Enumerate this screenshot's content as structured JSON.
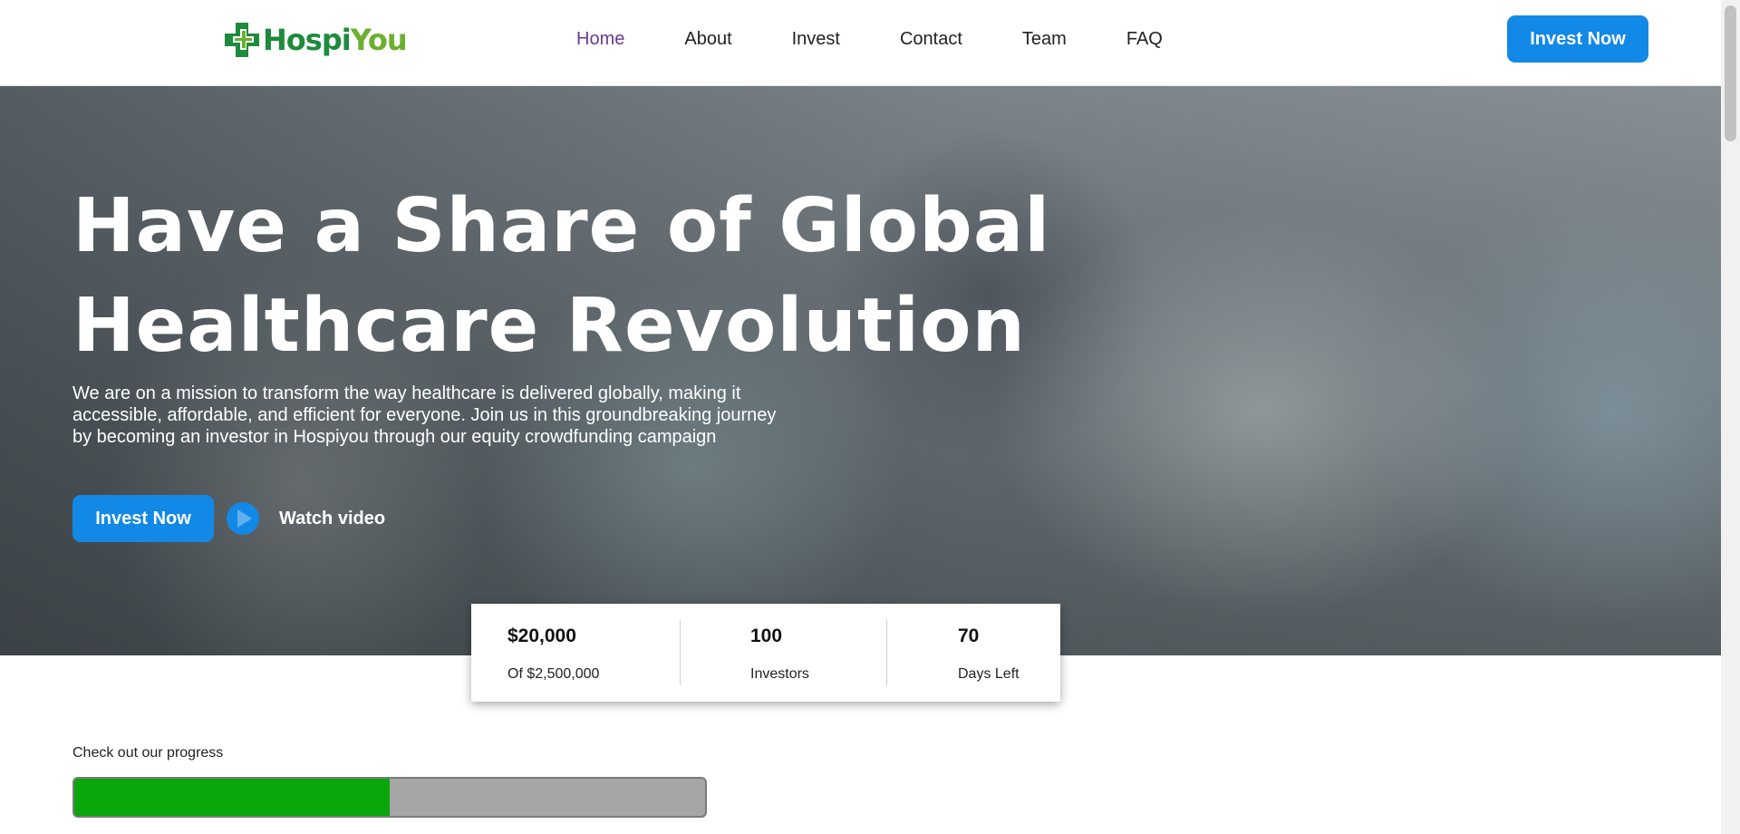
{
  "brand": {
    "name_part1": "Hospi",
    "name_part2": "You",
    "color_dark_green": "#1e8a3c",
    "color_light_green": "#6bb02e",
    "icon": "medical-cross-logo"
  },
  "nav": {
    "items": [
      {
        "label": "Home",
        "active": true
      },
      {
        "label": "About",
        "active": false
      },
      {
        "label": "Invest",
        "active": false
      },
      {
        "label": "Contact",
        "active": false
      },
      {
        "label": "Team",
        "active": false
      },
      {
        "label": "FAQ",
        "active": false
      }
    ],
    "active_color": "#6a3b8e"
  },
  "header": {
    "cta_label": "Invest Now"
  },
  "colors": {
    "accent_blue": "#1289e6",
    "progress_green": "#0aa70a"
  },
  "hero": {
    "title_line1": "Have a Share of Global",
    "title_line2": "Healthcare Revolution",
    "description": "We are on a mission to transform the way healthcare is delivered globally, making it accessible, affordable, and efficient for everyone. Join us in this groundbreaking journey by becoming an investor in Hospiyou through our equity crowdfunding campaign",
    "cta_label": "Invest Now",
    "video_label": "Watch video",
    "video_icon": "play-icon"
  },
  "stats": [
    {
      "value": "$20,000",
      "label": "Of $2,500,000"
    },
    {
      "value": "100",
      "label": "Investors"
    },
    {
      "value": "70",
      "label": "Days Left"
    }
  ],
  "progress": {
    "label": "Check out our progress",
    "fraction": 0.5
  }
}
